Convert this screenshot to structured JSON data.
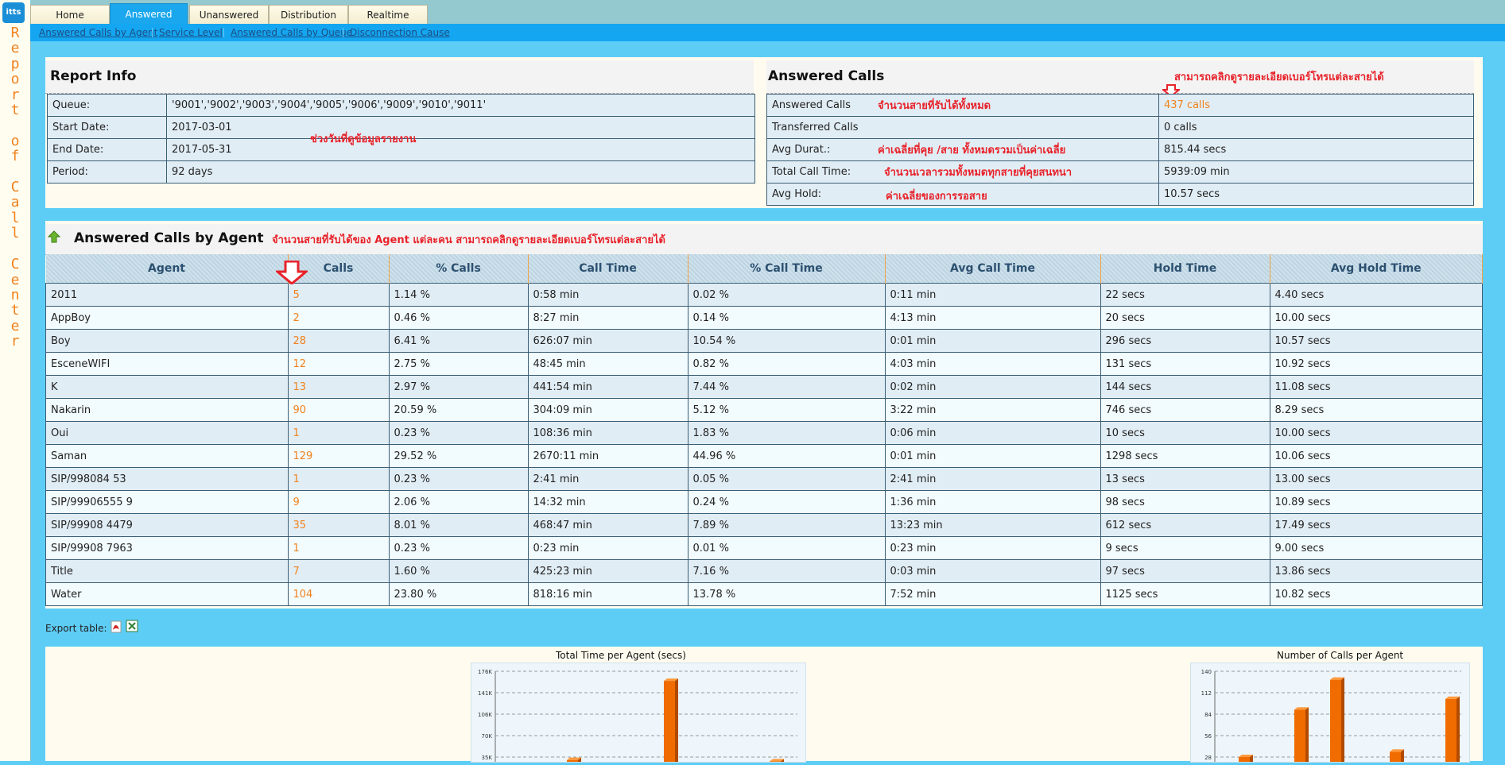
{
  "app": {
    "logo": "itts",
    "side_text": "Report of Call Center"
  },
  "tabs": [
    {
      "label": "Home",
      "active": false
    },
    {
      "label": "Answered",
      "active": true
    },
    {
      "label": "Unanswered",
      "active": false
    },
    {
      "label": "Distribution",
      "active": false
    },
    {
      "label": "Realtime",
      "active": false
    }
  ],
  "subnav": [
    "Answered Calls by Agent",
    "Service Level",
    "Answered Calls by Queue",
    "Disconnection Cause"
  ],
  "report_info": {
    "title": "Report Info",
    "rows": [
      {
        "label": "Queue:",
        "value": "'9001','9002','9003','9004','9005','9006','9009','9010','9011'"
      },
      {
        "label": "Start Date:",
        "value": "2017-03-01"
      },
      {
        "label": "End Date:",
        "value": "2017-05-31"
      },
      {
        "label": "Period:",
        "value": "92 days"
      }
    ],
    "note": "ช่วงวันที่ดูข้อมูลรายงาน"
  },
  "answered_calls": {
    "title": "Answered Calls",
    "note_top": "สามารถคลิกดูรายละเอียดเบอร์โทรแต่ละสายได้",
    "rows": [
      {
        "label": "Answered Calls",
        "value": "437 calls",
        "note": "จำนวนสายที่รับได้ทั้งหมด"
      },
      {
        "label": "Transferred Calls",
        "value": "0 calls",
        "note": ""
      },
      {
        "label": "Avg Durat.:",
        "value": "815.44 secs",
        "note": "ค่าเฉลี่ยที่คุย /สาย ทั้งหมดรวมเป็นค่าเฉลี่ย"
      },
      {
        "label": "Total Call Time:",
        "value": "5939:09 min",
        "note": "จำนวนเวลารวมทั้งหมดทุกสายที่คุยสนทนา"
      },
      {
        "label": "Avg Hold:",
        "value": "10.57 secs",
        "note": "ค่าเฉลี่ยของการรอสาย"
      }
    ]
  },
  "agents_section": {
    "title": "Answered Calls by Agent",
    "note": "จำนวนสายที่รับได้ของ Agent แต่ละคน สามารถคลิกดูรายละเอียดเบอร์โทรแต่ละสายได้",
    "columns": [
      "Agent",
      "Calls",
      "% Calls",
      "Call Time",
      "% Call Time",
      "Avg Call Time",
      "Hold Time",
      "Avg Hold Time"
    ],
    "rows": [
      [
        "2011",
        "5",
        "1.14 %",
        "0:58 min",
        "0.02 %",
        "0:11 min",
        "22 secs",
        "4.40 secs"
      ],
      [
        "AppBoy",
        "2",
        "0.46 %",
        "8:27 min",
        "0.14 %",
        "4:13 min",
        "20 secs",
        "10.00 secs"
      ],
      [
        "Boy",
        "28",
        "6.41 %",
        "626:07 min",
        "10.54 %",
        "0:01 min",
        "296 secs",
        "10.57 secs"
      ],
      [
        "EsceneWIFI",
        "12",
        "2.75 %",
        "48:45 min",
        "0.82 %",
        "4:03 min",
        "131 secs",
        "10.92 secs"
      ],
      [
        "K",
        "13",
        "2.97 %",
        "441:54 min",
        "7.44 %",
        "0:02 min",
        "144 secs",
        "11.08 secs"
      ],
      [
        "Nakarin",
        "90",
        "20.59 %",
        "304:09 min",
        "5.12 %",
        "3:22 min",
        "746 secs",
        "8.29 secs"
      ],
      [
        "Oui",
        "1",
        "0.23 %",
        "108:36 min",
        "1.83 %",
        "0:06 min",
        "10 secs",
        "10.00 secs"
      ],
      [
        "Saman",
        "129",
        "29.52 %",
        "2670:11 min",
        "44.96 %",
        "0:01 min",
        "1298 secs",
        "10.06 secs"
      ],
      [
        "SIP/998084      53",
        "1",
        "0.23 %",
        "2:41 min",
        "0.05 %",
        "2:41 min",
        "13 secs",
        "13.00 secs"
      ],
      [
        "SIP/99906555      9",
        "9",
        "2.06 %",
        "14:32 min",
        "0.24 %",
        "1:36 min",
        "98 secs",
        "10.89 secs"
      ],
      [
        "SIP/99908      4479",
        "35",
        "8.01 %",
        "468:47 min",
        "7.89 %",
        "13:23 min",
        "612 secs",
        "17.49 secs"
      ],
      [
        "SIP/99908      7963",
        "1",
        "0.23 %",
        "0:23 min",
        "0.01 %",
        "0:23 min",
        "9 secs",
        "9.00 secs"
      ],
      [
        "Title",
        "7",
        "1.60 %",
        "425:23 min",
        "7.16 %",
        "0:03 min",
        "97 secs",
        "13.86 secs"
      ],
      [
        "Water",
        "104",
        "23.80 %",
        "818:16 min",
        "13.78 %",
        "7:52 min",
        "1125 secs",
        "10.82 secs"
      ]
    ]
  },
  "export": {
    "label": "Export table:"
  },
  "chart_data": [
    {
      "type": "bar",
      "title": "Total Time per Agent (secs)",
      "yticks": [
        "176K",
        "141K",
        "106K",
        "70K",
        "35K"
      ],
      "ylim": [
        0,
        176000
      ],
      "values": [
        3480,
        30420,
        2925,
        160200,
        28125
      ]
    },
    {
      "type": "bar",
      "title": "Number of Calls per Agent",
      "yticks": [
        "140",
        "112",
        "84",
        "56",
        "28"
      ],
      "ylim": [
        0,
        140
      ],
      "values": [
        28,
        90,
        129,
        35,
        104
      ]
    }
  ],
  "colors": {
    "accent": "#f0821e",
    "note": "#e8222a",
    "background": "#5ecdf5",
    "active_tab": "#1aa7ee"
  }
}
